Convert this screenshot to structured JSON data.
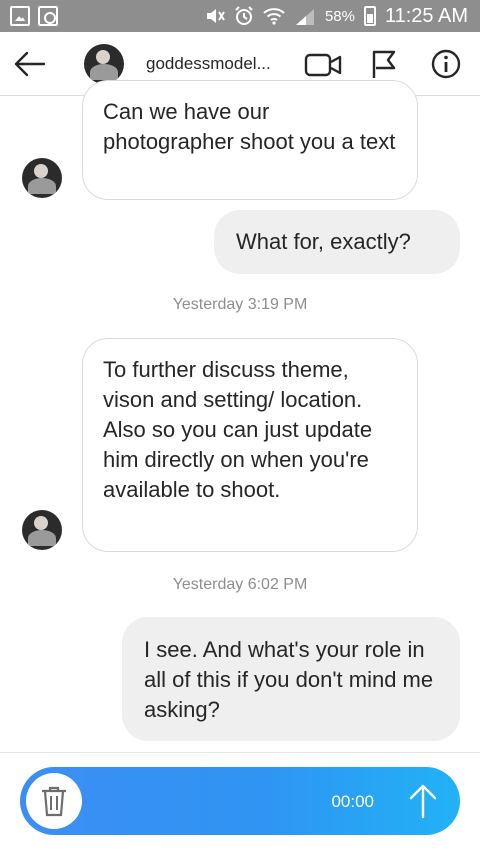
{
  "status_bar": {
    "battery_percent": "58%",
    "time": "11:25 AM"
  },
  "header": {
    "title": "goddessmodel..."
  },
  "messages": [
    {
      "direction": "incoming",
      "text": "Can we have our photographer shoot you a text"
    },
    {
      "direction": "outgoing",
      "text": "What for, exactly?"
    },
    {
      "type": "timestamp",
      "text": "Yesterday 3:19 PM"
    },
    {
      "direction": "incoming",
      "text": "To further discuss theme, vison and setting/ location. Also so you can just update him directly on when you're available to shoot."
    },
    {
      "type": "timestamp",
      "text": "Yesterday 6:02 PM"
    },
    {
      "direction": "outgoing",
      "text": "I see. And what's your role in all of this if you don't mind me asking?"
    }
  ],
  "composer": {
    "recording_time": "00:00"
  },
  "colors": {
    "status_bar": "#8e8e8e",
    "record_gradient_start": "#3d8ef4",
    "record_gradient_end": "#22b2f5",
    "incoming_border": "#dbdbdb",
    "outgoing_bg": "#efefef",
    "timestamp": "#8e8e8e"
  },
  "icons": [
    "image-icon",
    "shopping-bag-icon",
    "mute-icon",
    "alarm-icon",
    "wifi-icon",
    "signal-icon",
    "battery-icon",
    "back-arrow-icon",
    "video-call-icon",
    "flag-icon",
    "info-icon",
    "trash-icon",
    "send-arrow-icon"
  ]
}
